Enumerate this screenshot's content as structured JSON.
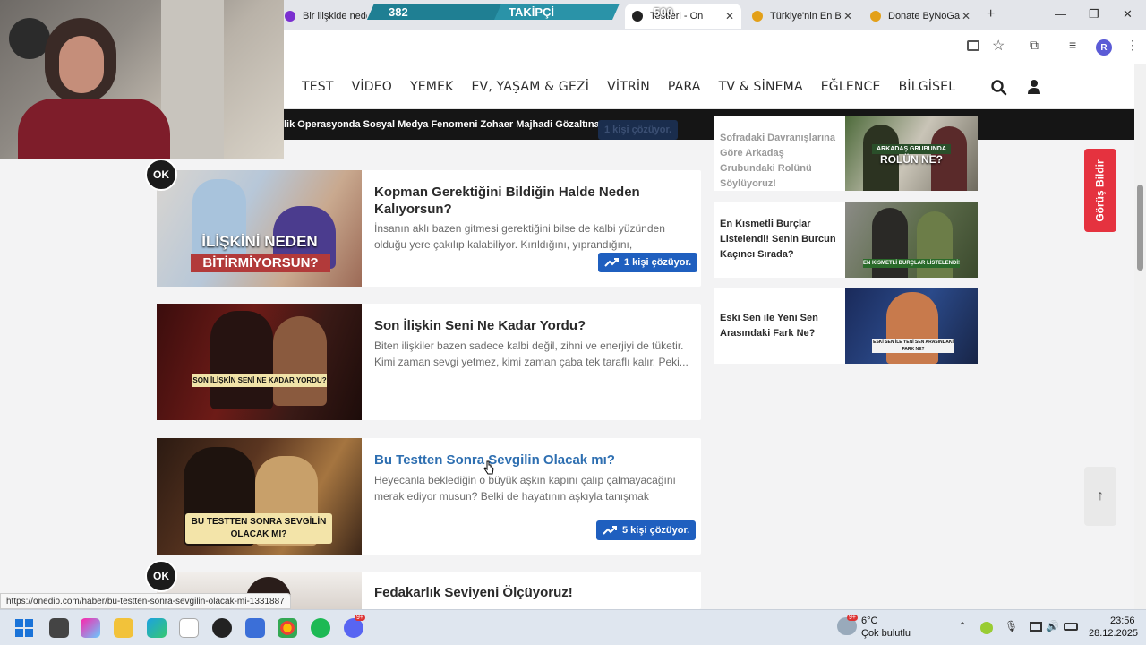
{
  "browser": {
    "tabs": [
      {
        "label": "Bir ilişkide neden"
      },
      {
        "label": "Testleri - On"
      },
      {
        "label": "Türkiye'nin En B"
      },
      {
        "label": "Donate ByNoGa"
      }
    ],
    "profile_initial": "R"
  },
  "stream_overlay": {
    "followers_count": "382",
    "followers_label": "TAKİPÇİ",
    "followers_goal": "500"
  },
  "nav": {
    "items": [
      "TEST",
      "VİDEO",
      "YEMEK",
      "EV, YAŞAM & GEZİ",
      "VİTRİN",
      "PARA",
      "TV & SİNEMA",
      "EĞLENCE",
      "BİLGİSEL"
    ]
  },
  "ticker": {
    "text": "lik Operasyonda Sosyal Medya Fenomeni Zohaer Majhadi Gözaltına Alındı",
    "pill": "1 kişi çözüyor."
  },
  "badge": {
    "label": "OK"
  },
  "articles": [
    {
      "title": "Kopman Gerektiğini Bildiğin Halde Neden Kalıyorsun?",
      "desc": "İnsanın aklı bazen gitmesi gerektiğini bilse de kalbi yüzünden olduğu yere çakılıp kalabiliyor. Kırıldığını, yıprandığını, huzurunun...",
      "solvers": "1 kişi çözüyor.",
      "thumb_caption_1": "İLİŞKİNİ NEDEN",
      "thumb_caption_2": "BİTİRMİYORSUN?"
    },
    {
      "title": "Son İlişkin Seni Ne Kadar Yordu?",
      "desc": "Biten ilişkiler bazen sadece kalbi değil, zihni ve enerjiyi de tüketir. Kimi zaman sevgi yetmez, kimi zaman çaba tek taraflı kalır. Peki...",
      "thumb_caption_1": "SON İLİŞKİN SENİ NE KADAR YORDU?"
    },
    {
      "title": "Bu Testten Sonra Sevgilin Olacak mı?",
      "desc": "Heyecanla beklediğin o büyük aşkın kapını çalıp çalmayacağını merak ediyor musun? Belki de hayatının aşkıyla tanışmak üzeresi...",
      "solvers": "5 kişi çözüyor.",
      "thumb_caption_1": "BU TESTTEN SONRA SEVGİLİN",
      "thumb_caption_2": "OLACAK MI?"
    },
    {
      "title": "Fedakarlık Seviyeni Ölçüyoruz!"
    }
  ],
  "sidebar": [
    {
      "text": "Sofradaki Davranışlarına Göre Arkadaş Grubundaki Rolünü Söylüyoruz!",
      "img_caption_1": "ARKADAŞ GRUBUNDA",
      "img_caption_2": "ROLÜN NE?"
    },
    {
      "text": "En Kısmetli Burçlar Listelendi! Senin Burcun Kaçıncı Sırada?",
      "img_caption_1": "EN KISMETLİ BURÇLAR LİSTELENDİ!"
    },
    {
      "text": "Eski Sen ile Yeni Sen Arasındaki Fark Ne?",
      "img_caption_1": "ESKİ SEN İLE YENİ SEN ARASINDAKİ",
      "img_caption_2": "FARK NE?"
    }
  ],
  "feedback_button": "Görüş Bildir",
  "status_url": "https://onedio.com/haber/bu-testten-sonra-sevgilin-olacak-mi-1331887",
  "taskbar": {
    "weather_temp": "6°C",
    "weather_desc": "Çok bulutlu",
    "time": "23:56",
    "date": "28.12.2025",
    "weather_badge": "9+",
    "discord_badge": "9+"
  },
  "colors": {
    "accent": "#1f5fbf",
    "feedback": "#e5323f",
    "ticker_bg": "#151515"
  }
}
